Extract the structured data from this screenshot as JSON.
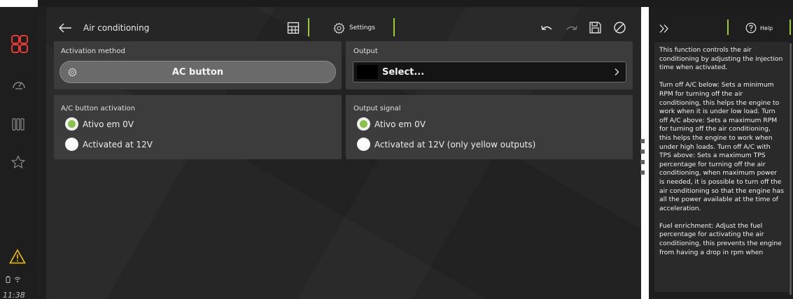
{
  "window": {
    "title": "Air conditioning"
  },
  "toolbar": {
    "settings_label": "Settings"
  },
  "rail": {
    "clock": "11:38"
  },
  "activation_method": {
    "label": "Activation method",
    "button_label": "AC button"
  },
  "output": {
    "label": "Output",
    "select_value": "Select..."
  },
  "ac_button_activation": {
    "label": "A/C button activation",
    "options": [
      {
        "label": "Ativo em 0V",
        "selected": true
      },
      {
        "label": "Activated at 12V",
        "selected": false
      }
    ]
  },
  "output_signal": {
    "label": "Output signal",
    "options": [
      {
        "label": "Ativo em 0V",
        "selected": true
      },
      {
        "label": "Activated at 12V (only yellow outputs)",
        "selected": false
      }
    ]
  },
  "help": {
    "button_label": "Help",
    "paragraphs": [
      "This function controls the air conditioning by adjusting the injection time when activated.",
      "Turn off A/C below: Sets a minimum RPM for turning off the air conditioning, this helps the engine to work when it is under low load. Turn off A/C above: Sets a maximum RPM for turning off the air conditioning, this helps the engine to work when under high loads. Turn off A/C with TPS above: Sets a maximum TPS percentage for turning off the air conditioning, when maximum power is needed, it is possible to turn off the air conditioning so that the engine has all the power available at the time of acceleration.",
      "Fuel enrichment: Adjust the fuel percentage for activating the air conditioning, this prevents the engine from having a drop in rpm when"
    ]
  },
  "colors": {
    "accent_green": "#9acd32",
    "radio_selected": "#8bc34a",
    "logo_red": "#e53935",
    "warning_yellow": "#f2c200"
  }
}
